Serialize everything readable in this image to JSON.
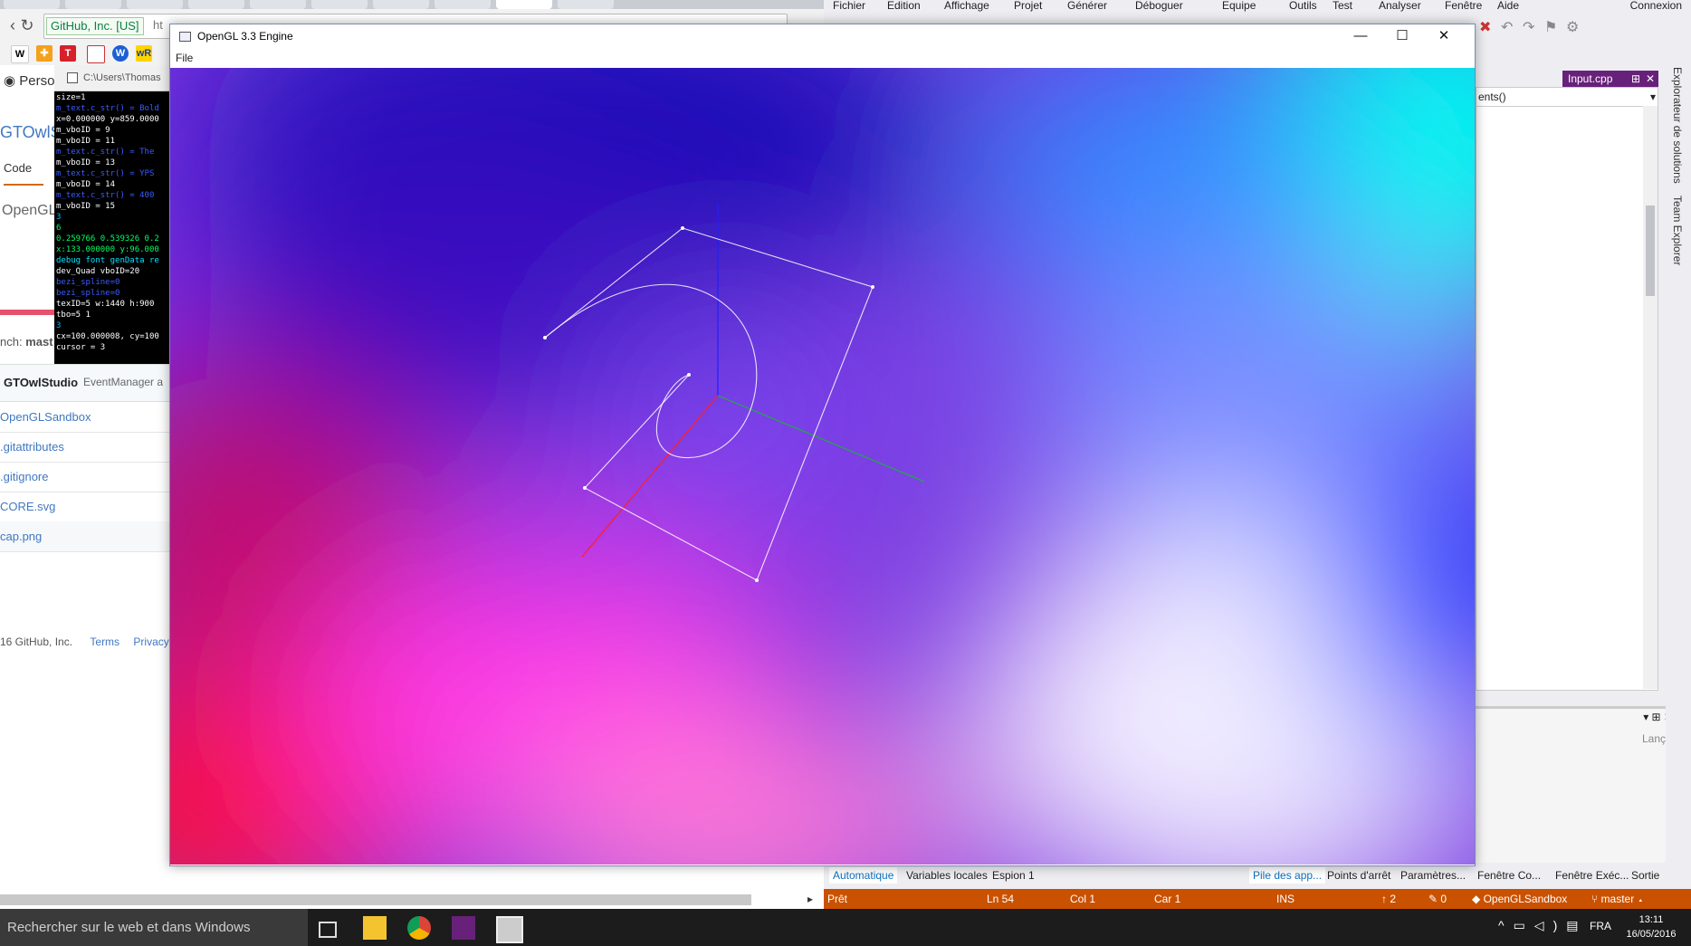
{
  "browser": {
    "omnibox": {
      "secure_label": "GitHub, Inc. [US]",
      "url": "ht"
    },
    "bookmarks": [
      "W",
      "W",
      "W",
      "W",
      "W"
    ],
    "github": {
      "nav_person": "Person",
      "repo_title": "GTOwlSt",
      "code_tab": "Code",
      "description": "OpenGL",
      "branch_label": "nch:",
      "branch_value": "mast",
      "commit_author": "GTOwlStudio",
      "commit_message": "EventManager a",
      "files": [
        "OpenGLSandbox",
        ".gitattributes",
        ".gitignore",
        "CORE.svg",
        "cap.png"
      ],
      "footer_copyright": "16 GitHub, Inc.",
      "footer_terms": "Terms",
      "footer_privacy": "Privacy"
    }
  },
  "console": {
    "title": "C:\\Users\\Thomas",
    "lines": [
      {
        "text": "size=1",
        "color": "#ffffff"
      },
      {
        "text": "m_text.c_str() = Bold",
        "color": "#3a5cff"
      },
      {
        "text": "x=0.000000 y=859.0000",
        "color": "#ffffff"
      },
      {
        "text": "m_vboID = 9",
        "color": "#ffffff"
      },
      {
        "text": "m_vboID = 11",
        "color": "#ffffff"
      },
      {
        "text": "m_text.c_str() = The",
        "color": "#3a5cff"
      },
      {
        "text": "m_vboID = 13",
        "color": "#ffffff"
      },
      {
        "text": "m_text.c_str() = YPS",
        "color": "#3a5cff"
      },
      {
        "text": "m_vboID = 14",
        "color": "#ffffff"
      },
      {
        "text": "m_text.c_str() = 400",
        "color": "#3a5cff"
      },
      {
        "text": "m_vboID = 15",
        "color": "#ffffff"
      },
      {
        "text": "3",
        "color": "#00b8ff"
      },
      {
        "text": "6",
        "color": "#00ff66"
      },
      {
        "text": "0.259766 0.539326 0.2",
        "color": "#00ff66"
      },
      {
        "text": "x:133.000000 y:96.000",
        "color": "#00ff66"
      },
      {
        "text": "debug font genData re",
        "color": "#00e5ff"
      },
      {
        "text": "dev_Quad vboID=20",
        "color": "#ffffff"
      },
      {
        "text": "bezi_spline=0",
        "color": "#3a5cff"
      },
      {
        "text": "bezi_spline=0",
        "color": "#3a5cff"
      },
      {
        "text": "texID=5 w:1440 h:900",
        "color": "#ffffff"
      },
      {
        "text": "tbo=5 1",
        "color": "#ffffff"
      },
      {
        "text": "3",
        "color": "#00b8ff"
      },
      {
        "text": "cx=100.000008, cy=100",
        "color": "#ffffff"
      },
      {
        "text": "cursor = 3",
        "color": "#ffffff"
      }
    ]
  },
  "visual_studio": {
    "menu": [
      "Fichier",
      "Edition",
      "Affichage",
      "Projet",
      "Générer",
      "Déboguer",
      "Equipe",
      "Outils",
      "Test",
      "Analyser",
      "Fenêtre",
      "Aide"
    ],
    "connection": "Connexion",
    "doc_tab": "Input.cpp",
    "editor_combo": "ents()",
    "side_labels": [
      "Explorateur de solutions",
      "Team Explorer"
    ],
    "panel_text": "Lanç",
    "bottom_tabs_left": [
      "Automatique",
      "Variables locales",
      "Espion 1"
    ],
    "bottom_tabs_right": [
      "Pile des app...",
      "Points d'arrêt",
      "Paramètres...",
      "Fenêtre Co...",
      "Fenêtre Exéc...",
      "Sortie"
    ],
    "status": {
      "ready": "Prêt",
      "line": "Ln 54",
      "col": "Col 1",
      "car": "Car 1",
      "ins": "INS",
      "push_count": "2",
      "pencil_count": "0",
      "repo": "OpenGLSandbox",
      "branch": "master"
    }
  },
  "gl_window": {
    "title": "OpenGL 3.3 Engine",
    "menu_file": "File",
    "controls": {
      "minimize": "—",
      "maximize": "☐",
      "close": "✕"
    }
  },
  "taskbar": {
    "search_placeholder": "Rechercher sur le web et dans Windows",
    "language": "FRA",
    "time": "13:11",
    "date": "16/05/2016"
  },
  "colors": {
    "vs_status": "#ca5100",
    "vs_accent": "#68217a",
    "taskbar": "#1c1c1c"
  }
}
